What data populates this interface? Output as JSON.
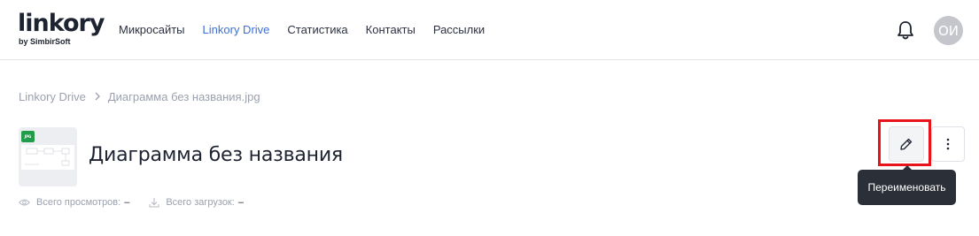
{
  "header": {
    "logo": {
      "wordmark": "linkory",
      "tagline": "by SimbirSoft"
    },
    "nav": [
      {
        "label": "Микросайты",
        "active": false
      },
      {
        "label": "Linkory Drive",
        "active": true
      },
      {
        "label": "Статистика",
        "active": false
      },
      {
        "label": "Контакты",
        "active": false
      },
      {
        "label": "Рассылки",
        "active": false
      }
    ],
    "notifications_icon": "bell-icon",
    "avatar_initials": "ОИ"
  },
  "breadcrumb": {
    "root": "Linkory Drive",
    "current": "Диаграмма без названия.jpg"
  },
  "file": {
    "type_badge": "JPG",
    "title": "Диаграмма без названия",
    "stats": {
      "views_label": "Всего просмотров:",
      "views_value": "–",
      "downloads_label": "Всего загрузок:",
      "downloads_value": "–"
    }
  },
  "actions": {
    "edit_icon": "pencil-icon",
    "more_icon": "more-vertical-icon",
    "tooltip": "Переименовать"
  },
  "colors": {
    "accent": "#3d6fd6",
    "highlight": "#e8141b",
    "jpg_badge": "#1f9d4a",
    "tooltip_bg": "#2b2f38"
  }
}
